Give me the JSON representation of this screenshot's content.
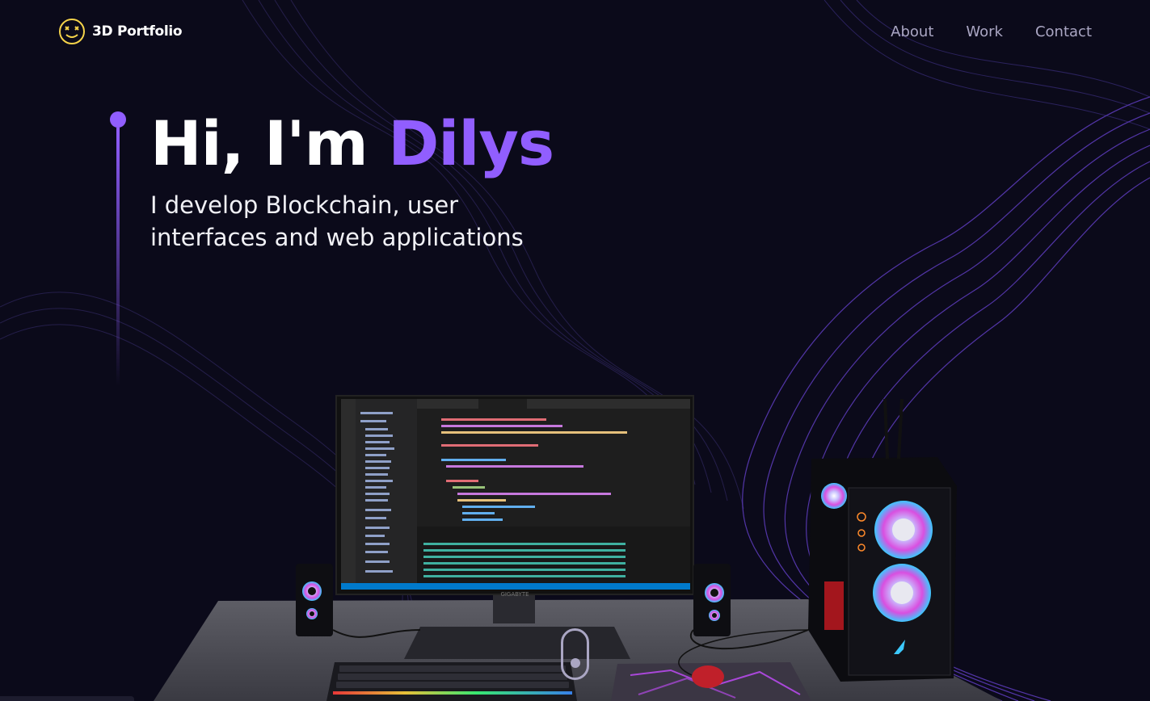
{
  "brand": {
    "name": "3D Portfolio",
    "logo_icon": "smiley-logo-icon"
  },
  "nav": {
    "items": [
      "About",
      "Work",
      "Contact"
    ]
  },
  "hero": {
    "greeting": "Hi, I'm ",
    "name": "Dilys",
    "subtitle_line1": "I develop Blockchain, user",
    "subtitle_line2": "interfaces and web applications"
  },
  "scene": {
    "monitor_brand": "GIGABYTE"
  },
  "colors": {
    "background": "#0b0a1a",
    "accent": "#915eff",
    "nav_text": "#aaa6c3",
    "logo": "#f5d34a"
  }
}
